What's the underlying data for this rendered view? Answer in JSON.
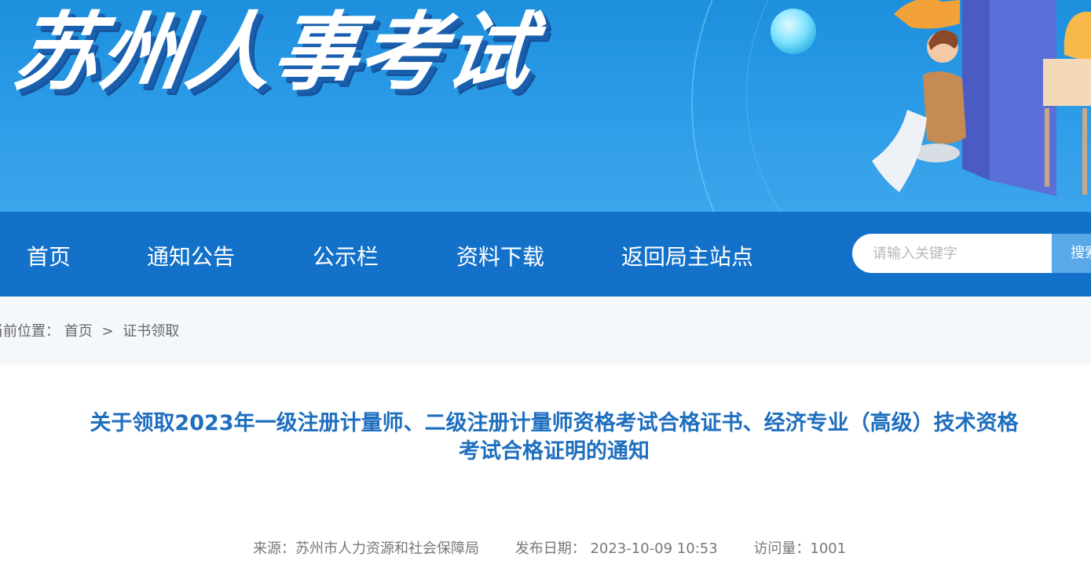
{
  "header": {
    "site_title": "苏州人事考试"
  },
  "nav": {
    "items": [
      {
        "label": "首页"
      },
      {
        "label": "通知公告"
      },
      {
        "label": "公示栏"
      },
      {
        "label": "资料下载"
      },
      {
        "label": "返回局主站点"
      }
    ],
    "search_placeholder": "请输入关键字",
    "search_button": "搜索"
  },
  "breadcrumb": {
    "prefix": "当前位置：",
    "home": "首页",
    "separator": ">",
    "current": "证书领取"
  },
  "article": {
    "title_line1": "关于领取2023年一级注册计量师、二级注册计量师资格考试合格证书、经济专业（高级）技术资格",
    "title_line2": "考试合格证明的通知",
    "source": "来源：苏州市人力资源和社会保障局",
    "date": "发布日期： 2023-10-09 10:53",
    "views": "访问量：1001"
  },
  "colors": {
    "banner": "#2a9ae6",
    "nav": "#1371c9",
    "title": "#1f6fbf",
    "breadcrumb_bg": "#f5f8fb"
  }
}
